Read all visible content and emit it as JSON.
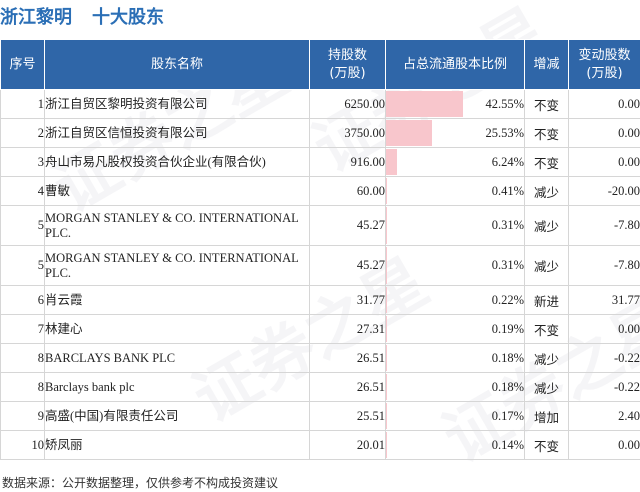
{
  "header": {
    "company": "浙江黎明",
    "section": "十大股东"
  },
  "columns": [
    "序号",
    "股东名称",
    "持股数\n(万股)",
    "占总流通股本比例",
    "增减",
    "变动股数\n(万股)"
  ],
  "rows": [
    {
      "idx": "1",
      "name": "浙江自贸区黎明投资有限公司",
      "shares": "6250.00",
      "ratio": "42.55%",
      "ratio_value": 42.55,
      "change": "不变",
      "delta": "0.00",
      "status": "same"
    },
    {
      "idx": "2",
      "name": "浙江自贸区信恒投资有限公司",
      "shares": "3750.00",
      "ratio": "25.53%",
      "ratio_value": 25.53,
      "change": "不变",
      "delta": "0.00",
      "status": "same"
    },
    {
      "idx": "3",
      "name": "舟山市易凡股权投资合伙企业(有限合伙)",
      "shares": "916.00",
      "ratio": "6.24%",
      "ratio_value": 6.24,
      "change": "不变",
      "delta": "0.00",
      "status": "same"
    },
    {
      "idx": "4",
      "name": "曹敏",
      "shares": "60.00",
      "ratio": "0.41%",
      "ratio_value": 0.41,
      "change": "减少",
      "delta": "-20.00",
      "status": "down"
    },
    {
      "idx": "5",
      "name": "MORGAN STANLEY & CO. INTERNATIONAL PLC.",
      "shares": "45.27",
      "ratio": "0.31%",
      "ratio_value": 0.31,
      "change": "减少",
      "delta": "-7.80",
      "status": "down"
    },
    {
      "idx": "5",
      "name": "MORGAN STANLEY & CO. INTERNATIONAL PLC.",
      "shares": "45.27",
      "ratio": "0.31%",
      "ratio_value": 0.31,
      "change": "减少",
      "delta": "-7.80",
      "status": "down"
    },
    {
      "idx": "6",
      "name": "肖云霞",
      "shares": "31.77",
      "ratio": "0.22%",
      "ratio_value": 0.22,
      "change": "新进",
      "delta": "31.77",
      "status": "up"
    },
    {
      "idx": "7",
      "name": "林建心",
      "shares": "27.31",
      "ratio": "0.19%",
      "ratio_value": 0.19,
      "change": "不变",
      "delta": "0.00",
      "status": "same"
    },
    {
      "idx": "8",
      "name": "BARCLAYS BANK PLC",
      "shares": "26.51",
      "ratio": "0.18%",
      "ratio_value": 0.18,
      "change": "减少",
      "delta": "-0.22",
      "status": "down"
    },
    {
      "idx": "8",
      "name": "Barclays bank plc",
      "shares": "26.51",
      "ratio": "0.18%",
      "ratio_value": 0.18,
      "change": "减少",
      "delta": "-0.22",
      "status": "down"
    },
    {
      "idx": "9",
      "name": "高盛(中国)有限责任公司",
      "shares": "25.51",
      "ratio": "0.17%",
      "ratio_value": 0.17,
      "change": "增加",
      "delta": "2.40",
      "status": "up"
    },
    {
      "idx": "10",
      "name": "矫凤丽",
      "shares": "20.01",
      "ratio": "0.14%",
      "ratio_value": 0.14,
      "change": "不变",
      "delta": "0.00",
      "status": "same"
    }
  ],
  "footer": "数据来源：公开数据整理，仅供参考不构成投资建议",
  "colors": {
    "header_bg": "#2f66a8",
    "title": "#2b6fb6",
    "bar": "#f8c6cc",
    "up": "#e02020",
    "down": "#1a8a2a"
  }
}
